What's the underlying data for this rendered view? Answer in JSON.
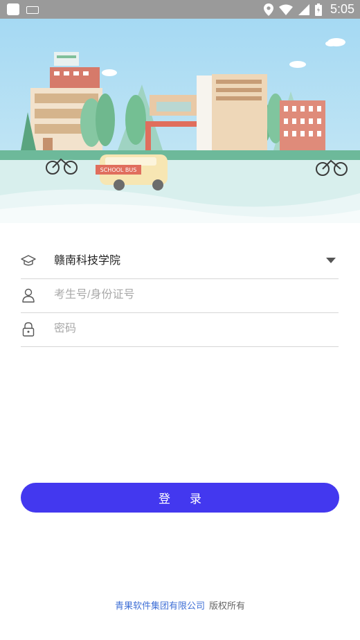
{
  "status_bar": {
    "time": "5:05",
    "icons": [
      "app-icon",
      "keyboard-icon",
      "location-icon",
      "wifi-icon",
      "signal-icon",
      "battery-icon"
    ]
  },
  "banner": {
    "bus_label": "SCHOOL BUS",
    "colors": {
      "sky": "#a9dcf2",
      "ground": "#d8efed"
    }
  },
  "form": {
    "school": {
      "value": "赣南科技学院",
      "icon": "graduation-cap-icon"
    },
    "account": {
      "placeholder": "考生号/身份证号",
      "icon": "user-icon"
    },
    "password": {
      "placeholder": "密码",
      "icon": "lock-icon"
    }
  },
  "login_button": {
    "label": "登录",
    "color": "#4338ef"
  },
  "footer": {
    "company": "青果软件集团有限公司",
    "rights": "版权所有"
  }
}
